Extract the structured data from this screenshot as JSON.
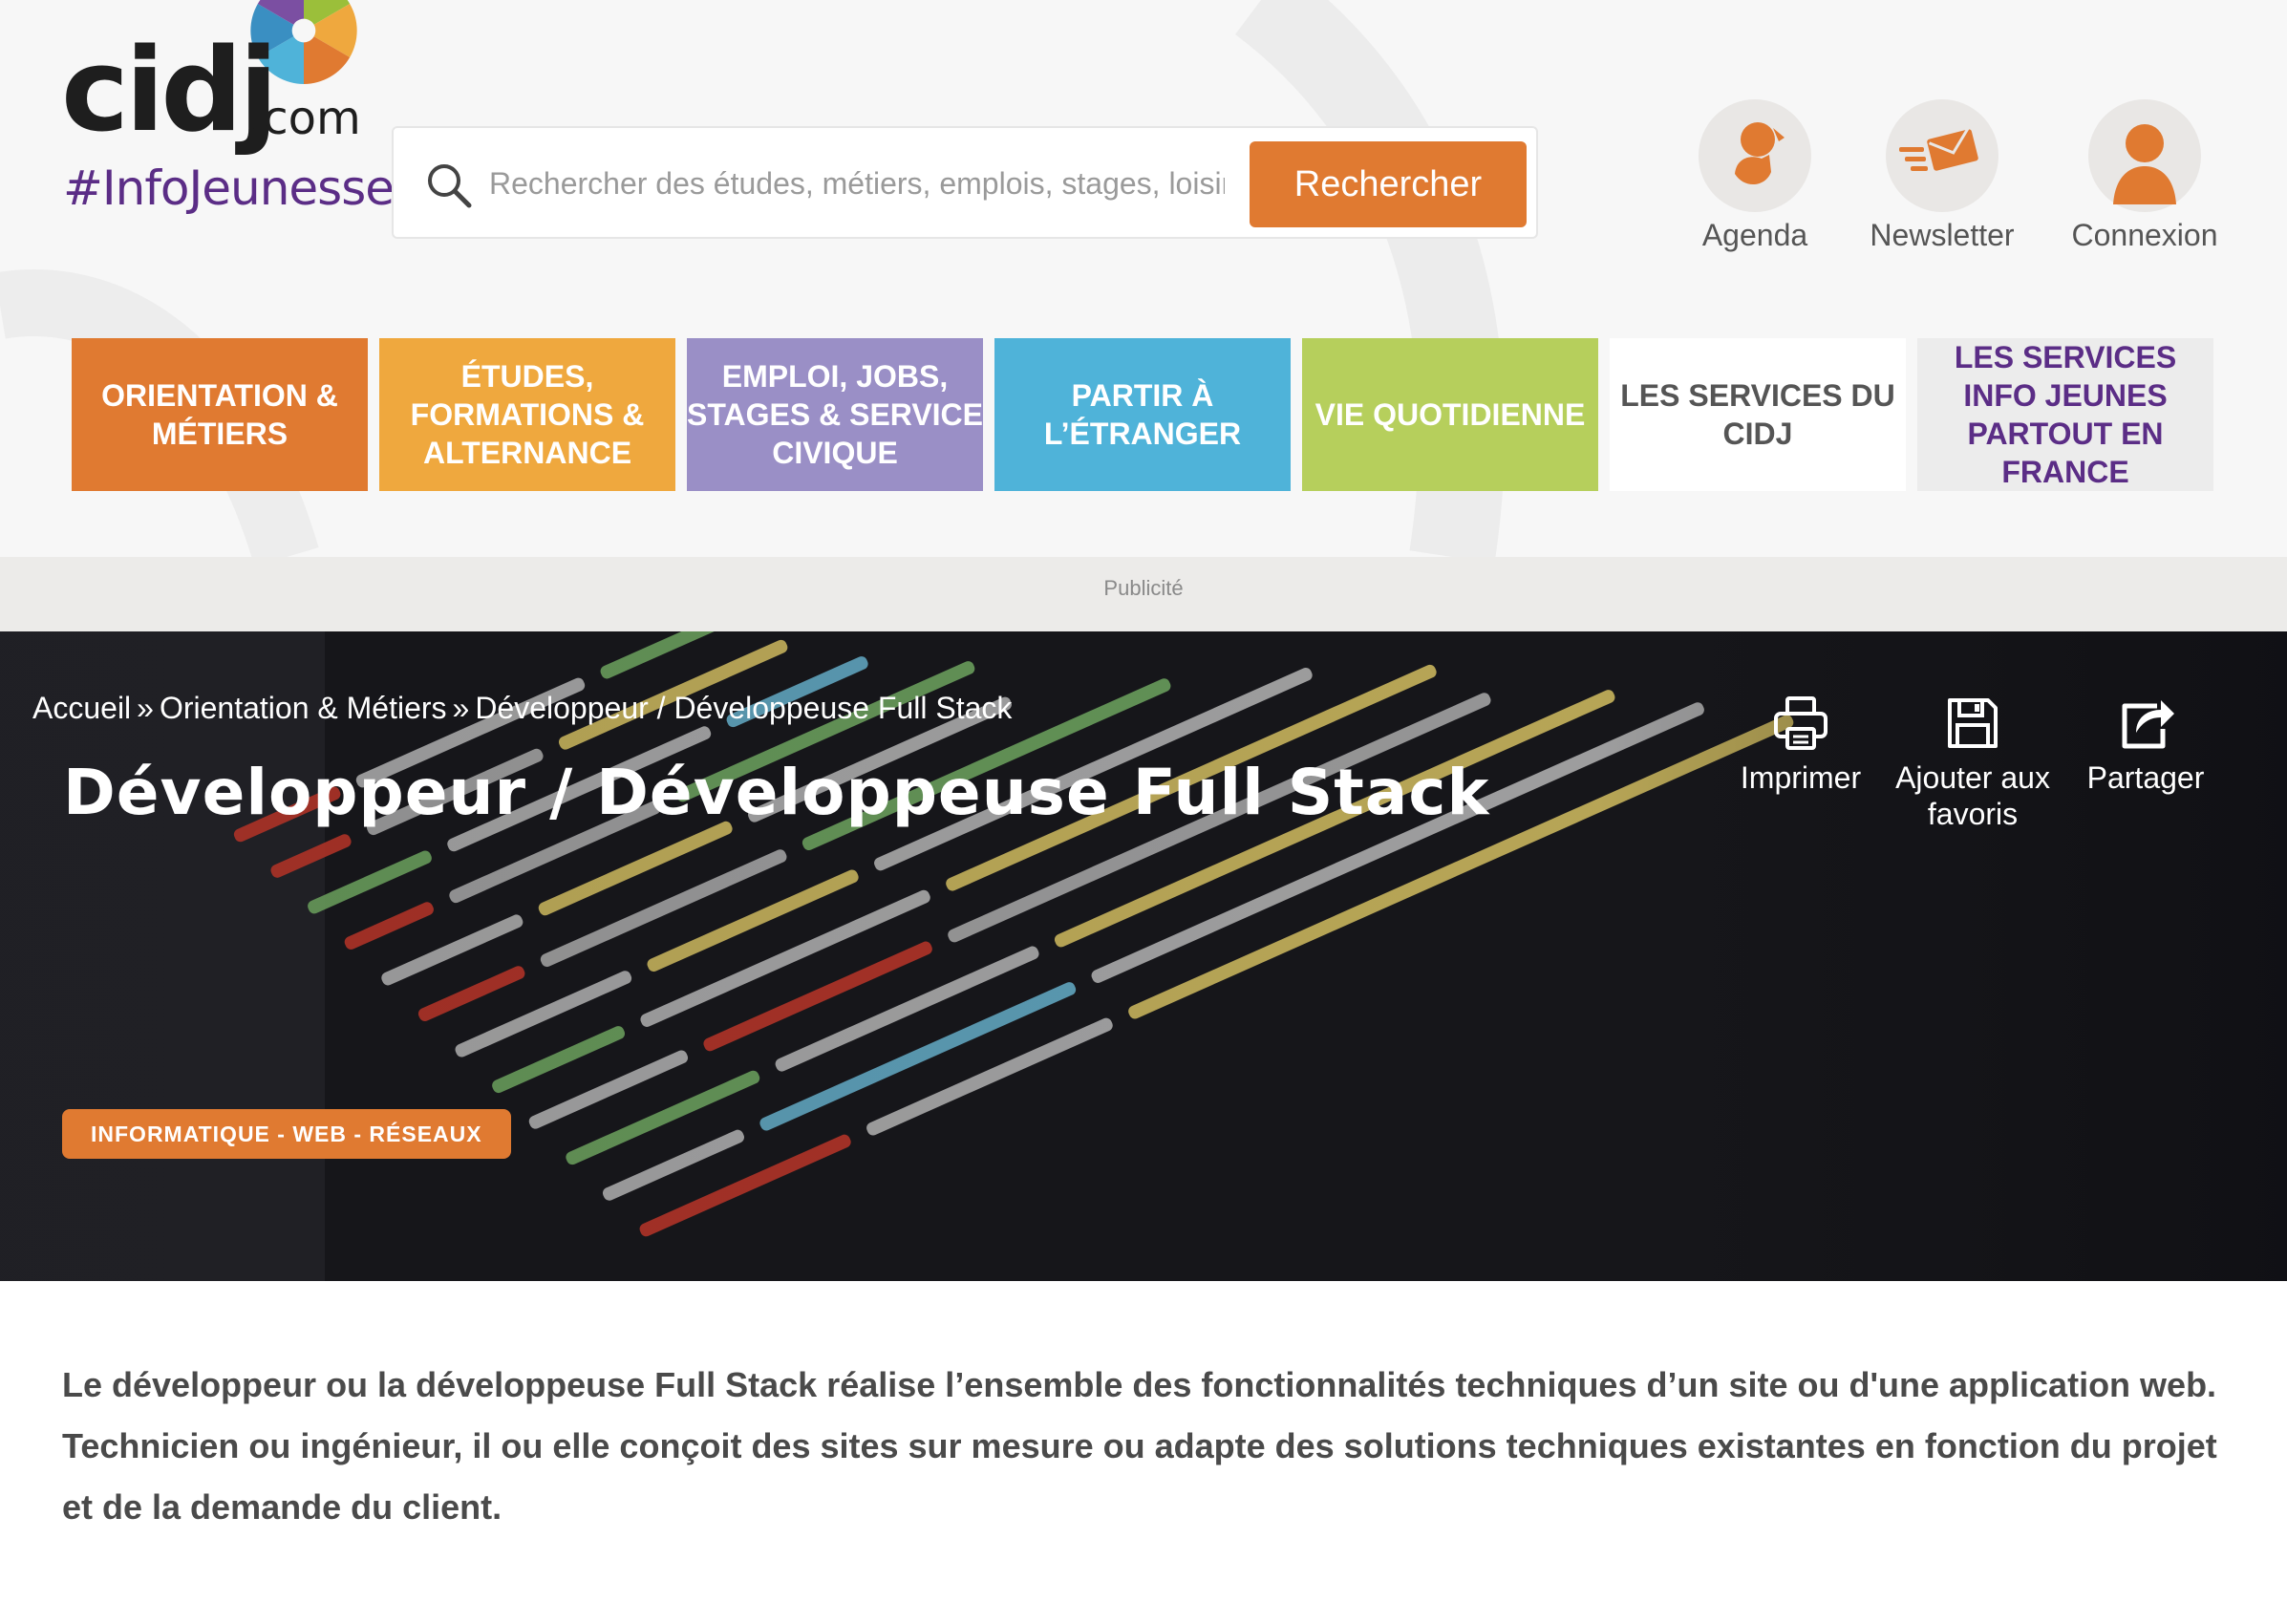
{
  "logo": {
    "brand": "cidj",
    "domain": ".com",
    "tagline": "#InfoJeunesse"
  },
  "search": {
    "placeholder": "Rechercher des études, métiers, emplois, stages, loisirs...",
    "button_label": "Rechercher"
  },
  "user_links": [
    {
      "label": "Agenda",
      "icon": "agenda-icon"
    },
    {
      "label": "Newsletter",
      "icon": "newsletter-icon"
    },
    {
      "label": "Connexion",
      "icon": "user-icon"
    }
  ],
  "nav": [
    {
      "label": "ORIENTATION & MÉTIERS",
      "bg": "#e07a31",
      "color": "#ffffff"
    },
    {
      "label": "ÉTUDES, FORMATIONS & ALTERNANCE",
      "bg": "#efa83e",
      "color": "#ffffff"
    },
    {
      "label": "EMPLOI, JOBS, STAGES & SERVICE CIVIQUE",
      "bg": "#9a8fc6",
      "color": "#ffffff"
    },
    {
      "label": "PARTIR À L’ÉTRANGER",
      "bg": "#4fb3d9",
      "color": "#ffffff"
    },
    {
      "label": "VIE QUOTIDIENNE",
      "bg": "#b6cf5c",
      "color": "#ffffff"
    },
    {
      "label": "LES SERVICES DU CIDJ",
      "bg": "#ffffff",
      "color": "#555555"
    },
    {
      "label": "LES SERVICES INFO JEUNES PARTOUT EN FRANCE",
      "bg": "#ececec",
      "color": "#5b2d86"
    }
  ],
  "ad": {
    "label": "Publicité"
  },
  "breadcrumb": [
    "Accueil",
    "Orientation & Métiers",
    "Développeur / Développeuse Full Stack"
  ],
  "breadcrumb_separator": "»",
  "page": {
    "title": "Développeur / Développeuse Full Stack",
    "category": "INFORMATIQUE - WEB - RÉSEAUX"
  },
  "tools": [
    {
      "label": "Imprimer",
      "icon": "print-icon"
    },
    {
      "label": "Ajouter aux favoris",
      "icon": "save-icon"
    },
    {
      "label": "Partager",
      "icon": "share-icon"
    }
  ],
  "intro": "Le développeur ou la développeuse Full Stack réalise l’ensemble des fonctionnalités techniques d’un site ou d'une application web. Technicien ou ingénieur, il ou elle conçoit des sites sur mesure ou adapte des solutions techniques existantes en fonction du projet et de la demande du client.",
  "colors": {
    "accent": "#e07a31",
    "brand_purple": "#5b2d86",
    "hero_bg": "#141418"
  }
}
